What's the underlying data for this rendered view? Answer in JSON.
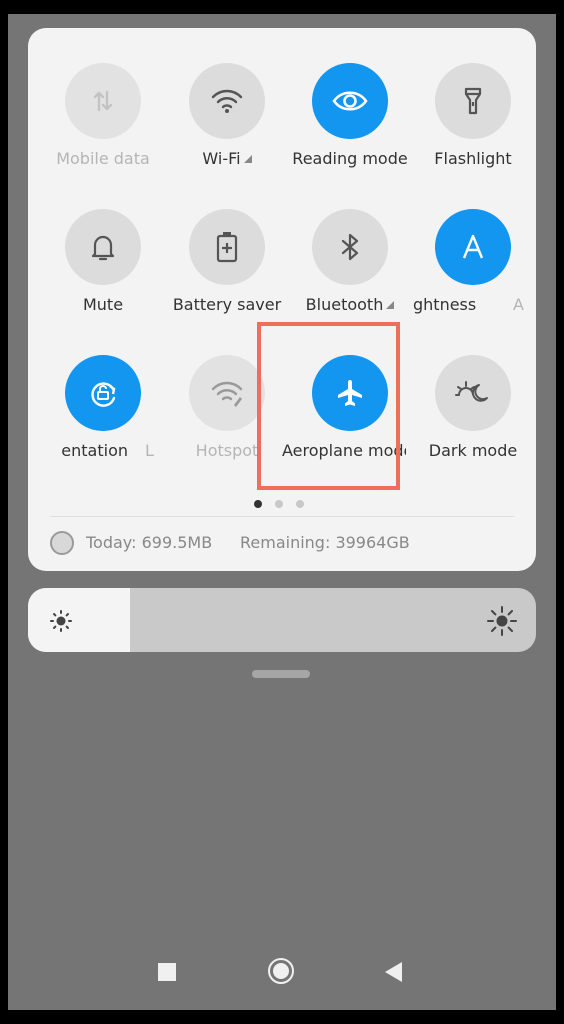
{
  "quick_settings": {
    "tiles": [
      {
        "id": "mobile-data",
        "label": "Mobile data",
        "state": "disabled",
        "icon": "mobile-data-icon"
      },
      {
        "id": "wifi",
        "label": "Wi-Fi",
        "state": "off",
        "icon": "wifi-icon"
      },
      {
        "id": "reading-mode",
        "label": "Reading mode",
        "state": "on",
        "icon": "eye-icon"
      },
      {
        "id": "flashlight",
        "label": "Flashlight",
        "state": "off",
        "icon": "flashlight-icon"
      },
      {
        "id": "mute",
        "label": "Mute",
        "state": "off",
        "icon": "bell-icon"
      },
      {
        "id": "battery-saver",
        "label": "Battery saver",
        "state": "off",
        "icon": "battery-icon"
      },
      {
        "id": "bluetooth",
        "label": "Bluetooth",
        "state": "off",
        "icon": "bluetooth-icon"
      },
      {
        "id": "auto-brightness",
        "label": "ghtness",
        "state": "on",
        "icon": "auto-brightness-icon"
      },
      {
        "id": "rotation",
        "label": "entation",
        "state": "on",
        "icon": "rotation-lock-icon"
      },
      {
        "id": "hotspot",
        "label": "Hotspot",
        "state": "disabled",
        "icon": "hotspot-icon"
      },
      {
        "id": "aeroplane-mode",
        "label": "Aeroplane mode",
        "state": "on",
        "icon": "airplane-icon"
      },
      {
        "id": "dark-mode",
        "label": "Dark mode",
        "state": "off",
        "icon": "dark-mode-icon"
      }
    ],
    "edge_fragments": {
      "row2_right": "A",
      "row3_middle": "L"
    },
    "page_indicator": {
      "pages": 3,
      "active": 1
    }
  },
  "data_usage": {
    "today": "Today: 699.5MB",
    "remaining": "Remaining: 39964GB"
  },
  "brightness": {
    "level": 0.2
  },
  "colors": {
    "accent": "#1296f0",
    "highlight": "#ef6e5b",
    "panel": "#f3f3f3",
    "backdrop": "#757575"
  }
}
